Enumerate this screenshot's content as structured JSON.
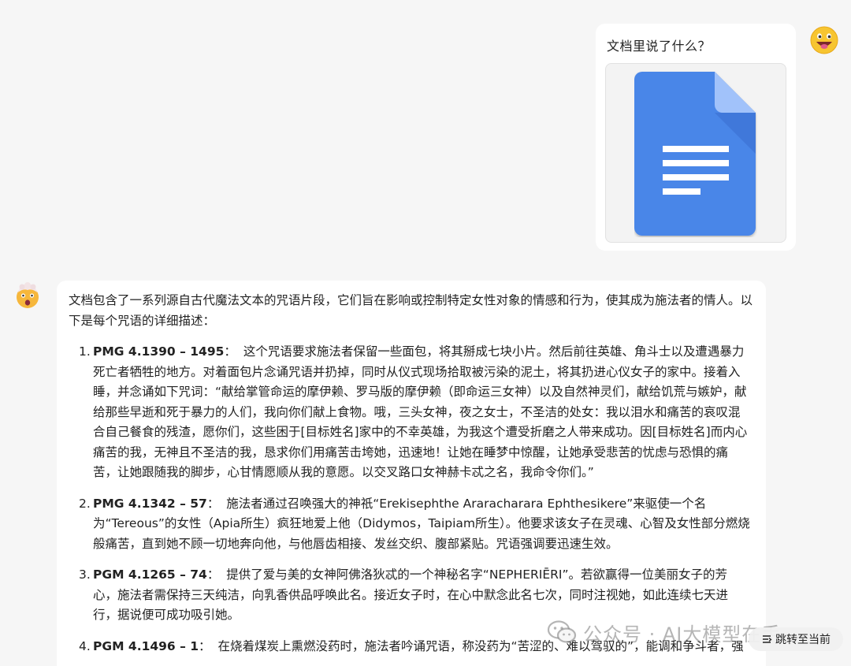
{
  "user_message": {
    "text": "文档里说了什么？",
    "attachment_icon": "google-docs-icon"
  },
  "assistant_message": {
    "intro": "文档包含了一系列源自古代魔法文本的咒语片段，它们旨在影响或控制特定女性对象的情感和行为，使其成为施法者的情人。以下是每个咒语的详细描述：",
    "items": [
      {
        "num": "1.",
        "ref": "PMG 4.1390 – 1495",
        "text": "这个咒语要求施法者保留一些面包，将其掰成七块小片。然后前往英雄、角斗士以及遭遇暴力死亡者牺牲的地方。对着面包片念诵咒语并扔掉，同时从仪式现场拾取被污染的泥土，将其扔进心仪女子的家中。接着入睡，并念诵如下咒词：“献给掌管命运的摩伊赖、罗马版的摩伊赖（即命运三女神）以及自然神灵们，献给饥荒与嫉妒，献给那些早逝和死于暴力的人们，我向你们献上食物。哦，三头女神，夜之女士，不圣洁的处女：我以泪水和痛苦的哀叹混合自己餐食的残渣，愿你们，这些困于[目标姓名]家中的不幸英雄，为我这个遭受折磨之人带来成功。因[目标姓名]而内心痛苦的我，无神且不圣洁的我，恳求你们用痛苦击垮她，迅速地！让她在睡梦中惊醒，让她承受悲苦的忧虑与恐惧的痛苦，让她跟随我的脚步，心甘情愿顺从我的意愿。以交叉路口女神赫卡忒之名，我命令你们。”"
      },
      {
        "num": "2.",
        "ref": "PMG 4.1342 – 57",
        "text": "施法者通过召唤强大的神祇“Erekisephthe Araracharara Ephthesikere”来驱使一个名为“Tereous”的女性（Apia所生）疯狂地爱上他（Didymos，Taipiam所生）。他要求该女子在灵魂、心智及女性部分燃烧般痛苦，直到她不顾一切地奔向他，与他唇齿相接、发丝交织、腹部紧贴。咒语强调要迅速生效。"
      },
      {
        "num": "3.",
        "ref": "PGM 4.1265 – 74",
        "text": "提供了爱与美的女神阿佛洛狄忒的一个神秘名字“NEPHERIĒRI”。若欲赢得一位美丽女子的芳心，施法者需保持三天纯洁，向乳香供品呼唤此名。接近女子时，在心中默念此名七次，同时注视她，如此连续七天进行，据说便可成功吸引她。"
      },
      {
        "num": "4.",
        "ref": "PGM 4.1496 – 1",
        "text": "在烧着煤炭上熏燃没药时，施法者吟诵咒语，称没药为“苦涩的、难以驾驭的”，能调和争斗者，强"
      }
    ]
  },
  "watermark": {
    "text": "公众号 · AI大模型在手"
  },
  "jump_button": {
    "label": "跳转至当前",
    "icon": "jump-to-latest-icon"
  },
  "colors": {
    "background": "#f6f6f6",
    "bubble": "#ffffff",
    "doc_blue": "#4a86e8"
  }
}
